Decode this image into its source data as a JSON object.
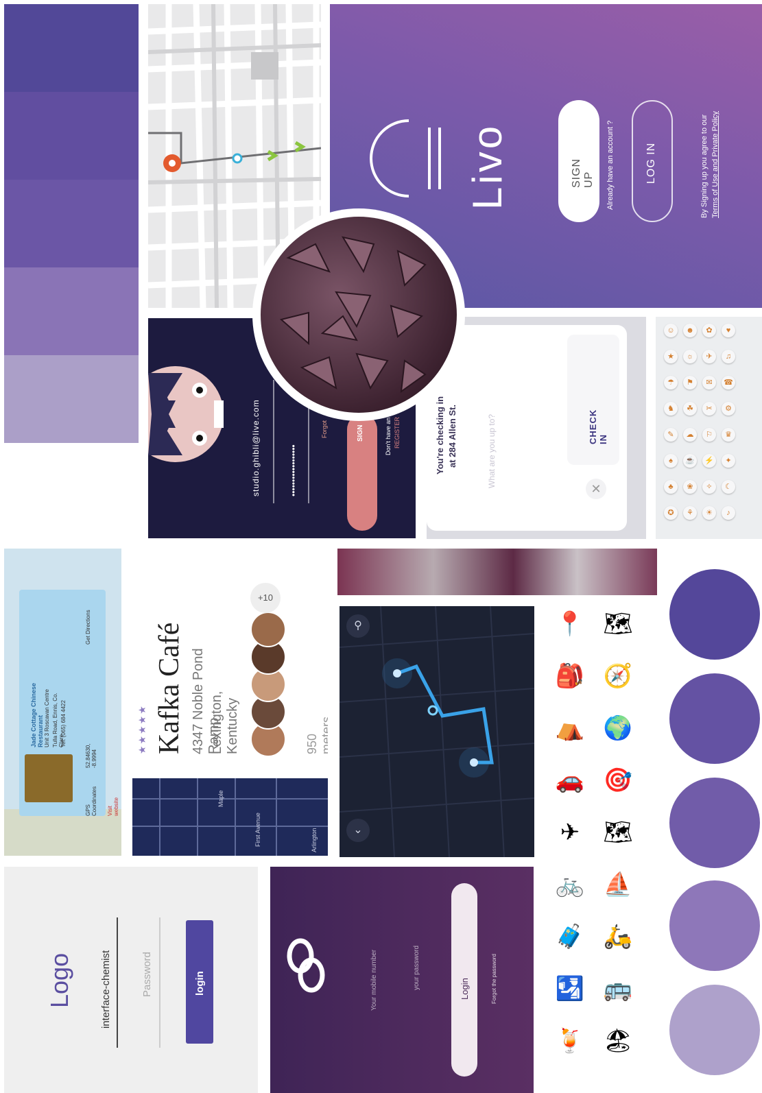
{
  "palette": {
    "swatches": [
      "#524898",
      "#614ea0",
      "#6b56a6",
      "#8a74b6",
      "#ab9fc8"
    ],
    "circles": [
      "#54479a",
      "#6452a3",
      "#715ca9",
      "#8e77b9",
      "#aea1cb"
    ]
  },
  "livo": {
    "brand": "Livo",
    "signup": "SIGN UP",
    "have_account": "Already have an account ?",
    "login": "LOG IN",
    "terms_1": "By Signing up you agree to our",
    "terms_2": "Terms of Use and Private Policy"
  },
  "totoro_login": {
    "email": "studio.ghibli@live.com",
    "password": "••••••••••••••••••",
    "forgot": "Forgot",
    "signin": "SIGN",
    "no_account": "Don't have an a",
    "register": "REGISTER"
  },
  "checkin": {
    "title_1": "You're checking in",
    "title_2": "at 284 Allen St.",
    "placeholder": "What are you up to?",
    "button": "CHECK IN"
  },
  "emoji_keys": [
    "☺",
    "☻",
    "✿",
    "♥",
    "★",
    "☼",
    "✈",
    "♫",
    "☂",
    "⚑",
    "✉",
    "☎",
    "♞",
    "☘",
    "✂",
    "⚙",
    "✎",
    "☁",
    "⚐",
    "♛",
    "♠",
    "☕",
    "⚡",
    "✦",
    "♣",
    "❀",
    "✧",
    "☾",
    "✪",
    "⚘",
    "☀",
    "♪"
  ],
  "business": {
    "name": "Jade Cottage Chinese Restaurant",
    "address_1": "Unit 3 Roscavan Centre",
    "address_2": "Tulla Road, Ennis, Co. Clare",
    "phone": "Tel: (065) 684 4422",
    "gps_label": "GPS Coordinates",
    "gps_value": "52.84630, -8.9994",
    "directions": "Get Directions",
    "visit": "Visit website"
  },
  "kafka": {
    "rating": "★★★★★",
    "name": "Kafka Café",
    "address_1": "4347 Noble Pond Ramp",
    "address_2": "Lexington, Kentucky",
    "more": "+10",
    "distance": "950 meters",
    "map_street_1": "Maple",
    "map_street_2": "First Avenue",
    "map_street_3": "Arlington"
  },
  "dark_map": {
    "search_icon": "search-icon",
    "chevron_icon": "chevron-down-icon"
  },
  "travel_icons": [
    "📍",
    "🎒",
    "⛺",
    "🚗",
    "✈",
    "🚲",
    "🧳",
    "🛂",
    "🍹",
    "🗺",
    "🧭",
    "🌍",
    "🎯",
    "🗺",
    "⛵",
    "🛵",
    "🚌",
    "🏖"
  ],
  "login_grey": {
    "logo": "Logo",
    "username": "interface-chemist",
    "password_placeholder": "Password",
    "button": "login"
  },
  "login_purple": {
    "mobile_placeholder": "Your mobile number",
    "password_placeholder": "your password",
    "button": "Login",
    "forgot": "Forgot the password"
  }
}
